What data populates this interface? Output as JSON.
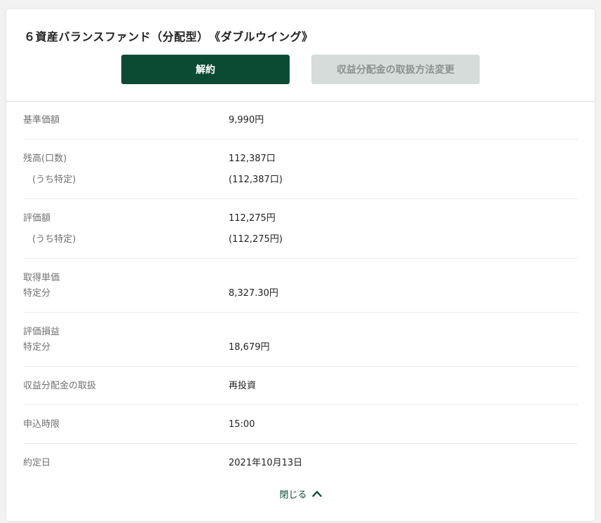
{
  "fund": {
    "title": "６資産バランスファンド（分配型）　《ダブルウイング》"
  },
  "buttons": {
    "cancel_label": "解約",
    "dividend_change_label": "収益分配金の取扱方法変更"
  },
  "details": {
    "base_price": {
      "label": "基準価額",
      "value": "9,990円"
    },
    "balance": {
      "label": "残高(口数)",
      "value": "112,387口",
      "sub_label": "(うち特定)",
      "sub_value": "(112,387口)"
    },
    "valuation": {
      "label": "評価額",
      "value": "112,275円",
      "sub_label": "(うち特定)",
      "sub_value": "(112,275円)"
    },
    "acquisition_price": {
      "label": "取得単価",
      "sub_label": "特定分",
      "sub_value": "8,327.30円"
    },
    "gain_loss": {
      "label": "評価損益",
      "sub_label": "特定分",
      "sub_value": "18,679円"
    },
    "dividend_handling": {
      "label": "収益分配金の取扱",
      "value": "再投資"
    },
    "order_deadline": {
      "label": "申込時限",
      "value": "15:00"
    },
    "contract_date": {
      "label": "約定日",
      "value": "2021年10月13日"
    }
  },
  "footer": {
    "close_label": "閉じる",
    "close_icon": "chevron-up-icon"
  },
  "colors": {
    "primary": "#0b4a33",
    "disabled_bg": "#d6dcda",
    "disabled_text": "#8a9290"
  }
}
